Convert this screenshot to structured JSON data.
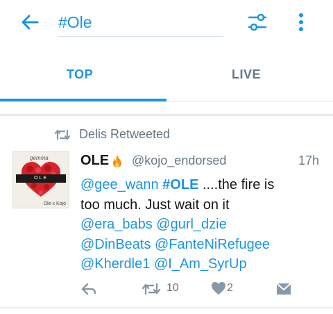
{
  "search": {
    "query": "#Ole",
    "back_icon": "arrow-left-icon",
    "filter_icon": "sliders-icon",
    "more_icon": "vertical-dots-icon"
  },
  "tabs": [
    {
      "label": "TOP",
      "active": true
    },
    {
      "label": "LIVE",
      "active": false
    }
  ],
  "colors": {
    "accent": "#1b95e0",
    "text": "#14171a",
    "muted": "#657786",
    "divider": "#e6ecf0"
  },
  "tweet": {
    "retweeted_by": "Delis Retweeted",
    "author_name": "OLE",
    "author_emoji": "fire",
    "handle": "@kojo_endorsed",
    "time": "17h",
    "avatar": {
      "caption": "gemma",
      "banner": "OLE",
      "footer": "Ole x Kojo"
    },
    "body": {
      "line1": {
        "mention": "@gee_wann",
        "hashtag": "#OLE",
        "rest": " ....the fire is"
      },
      "line2": "too much. Just wait on it",
      "line3": {
        "m1": "@era_babs",
        "m2": "@gurl_dzie"
      },
      "line4": {
        "m1": "@DinBeats",
        "m2": "@FanteNiRefugee"
      },
      "line5": {
        "m1": "@Kherdle1",
        "m2": "@I_Am_SyrUp"
      }
    },
    "actions": {
      "retweet_count": "10",
      "like_count": "2"
    }
  }
}
